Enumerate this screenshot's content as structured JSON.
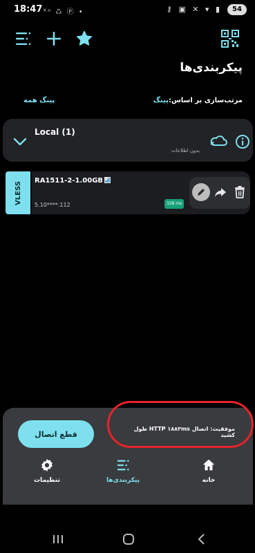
{
  "statusbar": {
    "time": "18:47",
    "left_icons": "ᴷᵒ ♺ ⓟ •",
    "right_icons": "⚷ ▣ ✕ ▾ ▮",
    "battery": "54"
  },
  "toolbar": {
    "icons": [
      "menu-icon",
      "add-icon",
      "star-icon",
      "qr-scan-icon"
    ]
  },
  "page": {
    "title": "پیکربندی‌ها"
  },
  "sort": {
    "label_prefix": "مرتب‌سازی بر اساس:",
    "label_value": "پینگ",
    "ping_all": "پینگ همه"
  },
  "group": {
    "name": "Local (1)",
    "subtitle": "بدون اطلاعات",
    "icons": [
      "chevron-down-icon",
      "cloud-icon",
      "info-icon"
    ]
  },
  "server": {
    "protocol": "VLESS",
    "name": "RA1511-2-1.00GB",
    "address": "5.10****.112",
    "latency": "328 ms",
    "icons": [
      "signal-bars-icon",
      "edit-icon",
      "share-icon",
      "delete-icon"
    ]
  },
  "bottom": {
    "disconnect_label": "قطع اتصال",
    "status_message": "موفقیت: اتصال HTTP ۱۸۸۳ms طول کشید",
    "accent_color": "#7ee0ef",
    "highlight_color": "#e8232a",
    "nav": [
      {
        "label": "تنظیمات",
        "icon": "gear-icon"
      },
      {
        "label": "پیکربندی‌ها",
        "icon": "list-icon"
      },
      {
        "label": "خانه",
        "icon": "home-icon"
      }
    ]
  },
  "system_nav": {
    "icons": [
      "recents-icon",
      "home-circle-icon",
      "back-icon"
    ]
  }
}
